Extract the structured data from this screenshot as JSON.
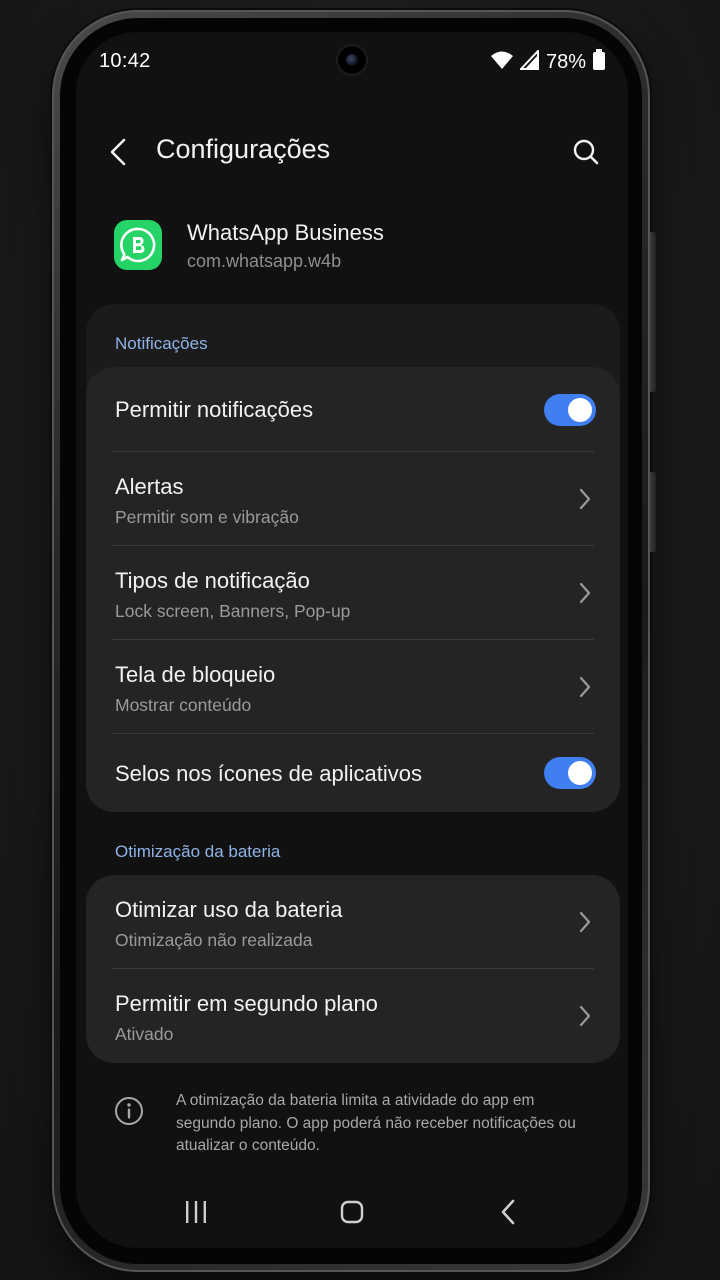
{
  "status_bar": {
    "time": "10:42",
    "battery_percent": "78%",
    "icons": [
      "wifi-icon",
      "signal-icon",
      "battery-icon"
    ]
  },
  "header": {
    "title": "Configurações",
    "back_icon": "back-arrow-icon",
    "search_icon": "search-icon"
  },
  "app": {
    "name": "WhatsApp Business",
    "package": "com.whatsapp.w4b",
    "icon": "whatsapp-business-icon",
    "icon_color": "#25d366"
  },
  "notifications": {
    "header": "Notificações",
    "items": [
      {
        "title": "Permitir notificações",
        "toggle": true
      },
      {
        "title": "Alertas",
        "subtitle": "Permitir som e vibração"
      },
      {
        "title": "Tipos de notificação",
        "subtitle": "Lock screen, Banners, Pop-up"
      },
      {
        "title": "Tela de bloqueio",
        "subtitle": "Mostrar conteúdo"
      },
      {
        "title": "Selos nos ícones de aplicativos",
        "toggle": true
      }
    ]
  },
  "battery": {
    "header": "Otimização da bateria",
    "items": [
      {
        "title": "Otimizar uso da bateria",
        "subtitle": "Otimização não realizada"
      },
      {
        "title": "Permitir em segundo plano",
        "subtitle": "Ativado"
      }
    ]
  },
  "info_note": {
    "icon": "info-icon",
    "text": "A otimização da bateria limita a atividade do app em segundo plano. O app poderá não receber notificações ou atualizar o conteúdo."
  },
  "nav_bar": {
    "icons": [
      "recents-icon",
      "home-icon",
      "back-icon"
    ]
  },
  "colors": {
    "accent": "#3f7ff0",
    "section_header": "#8fb3e8",
    "background": "#111111",
    "card": "#242424"
  }
}
